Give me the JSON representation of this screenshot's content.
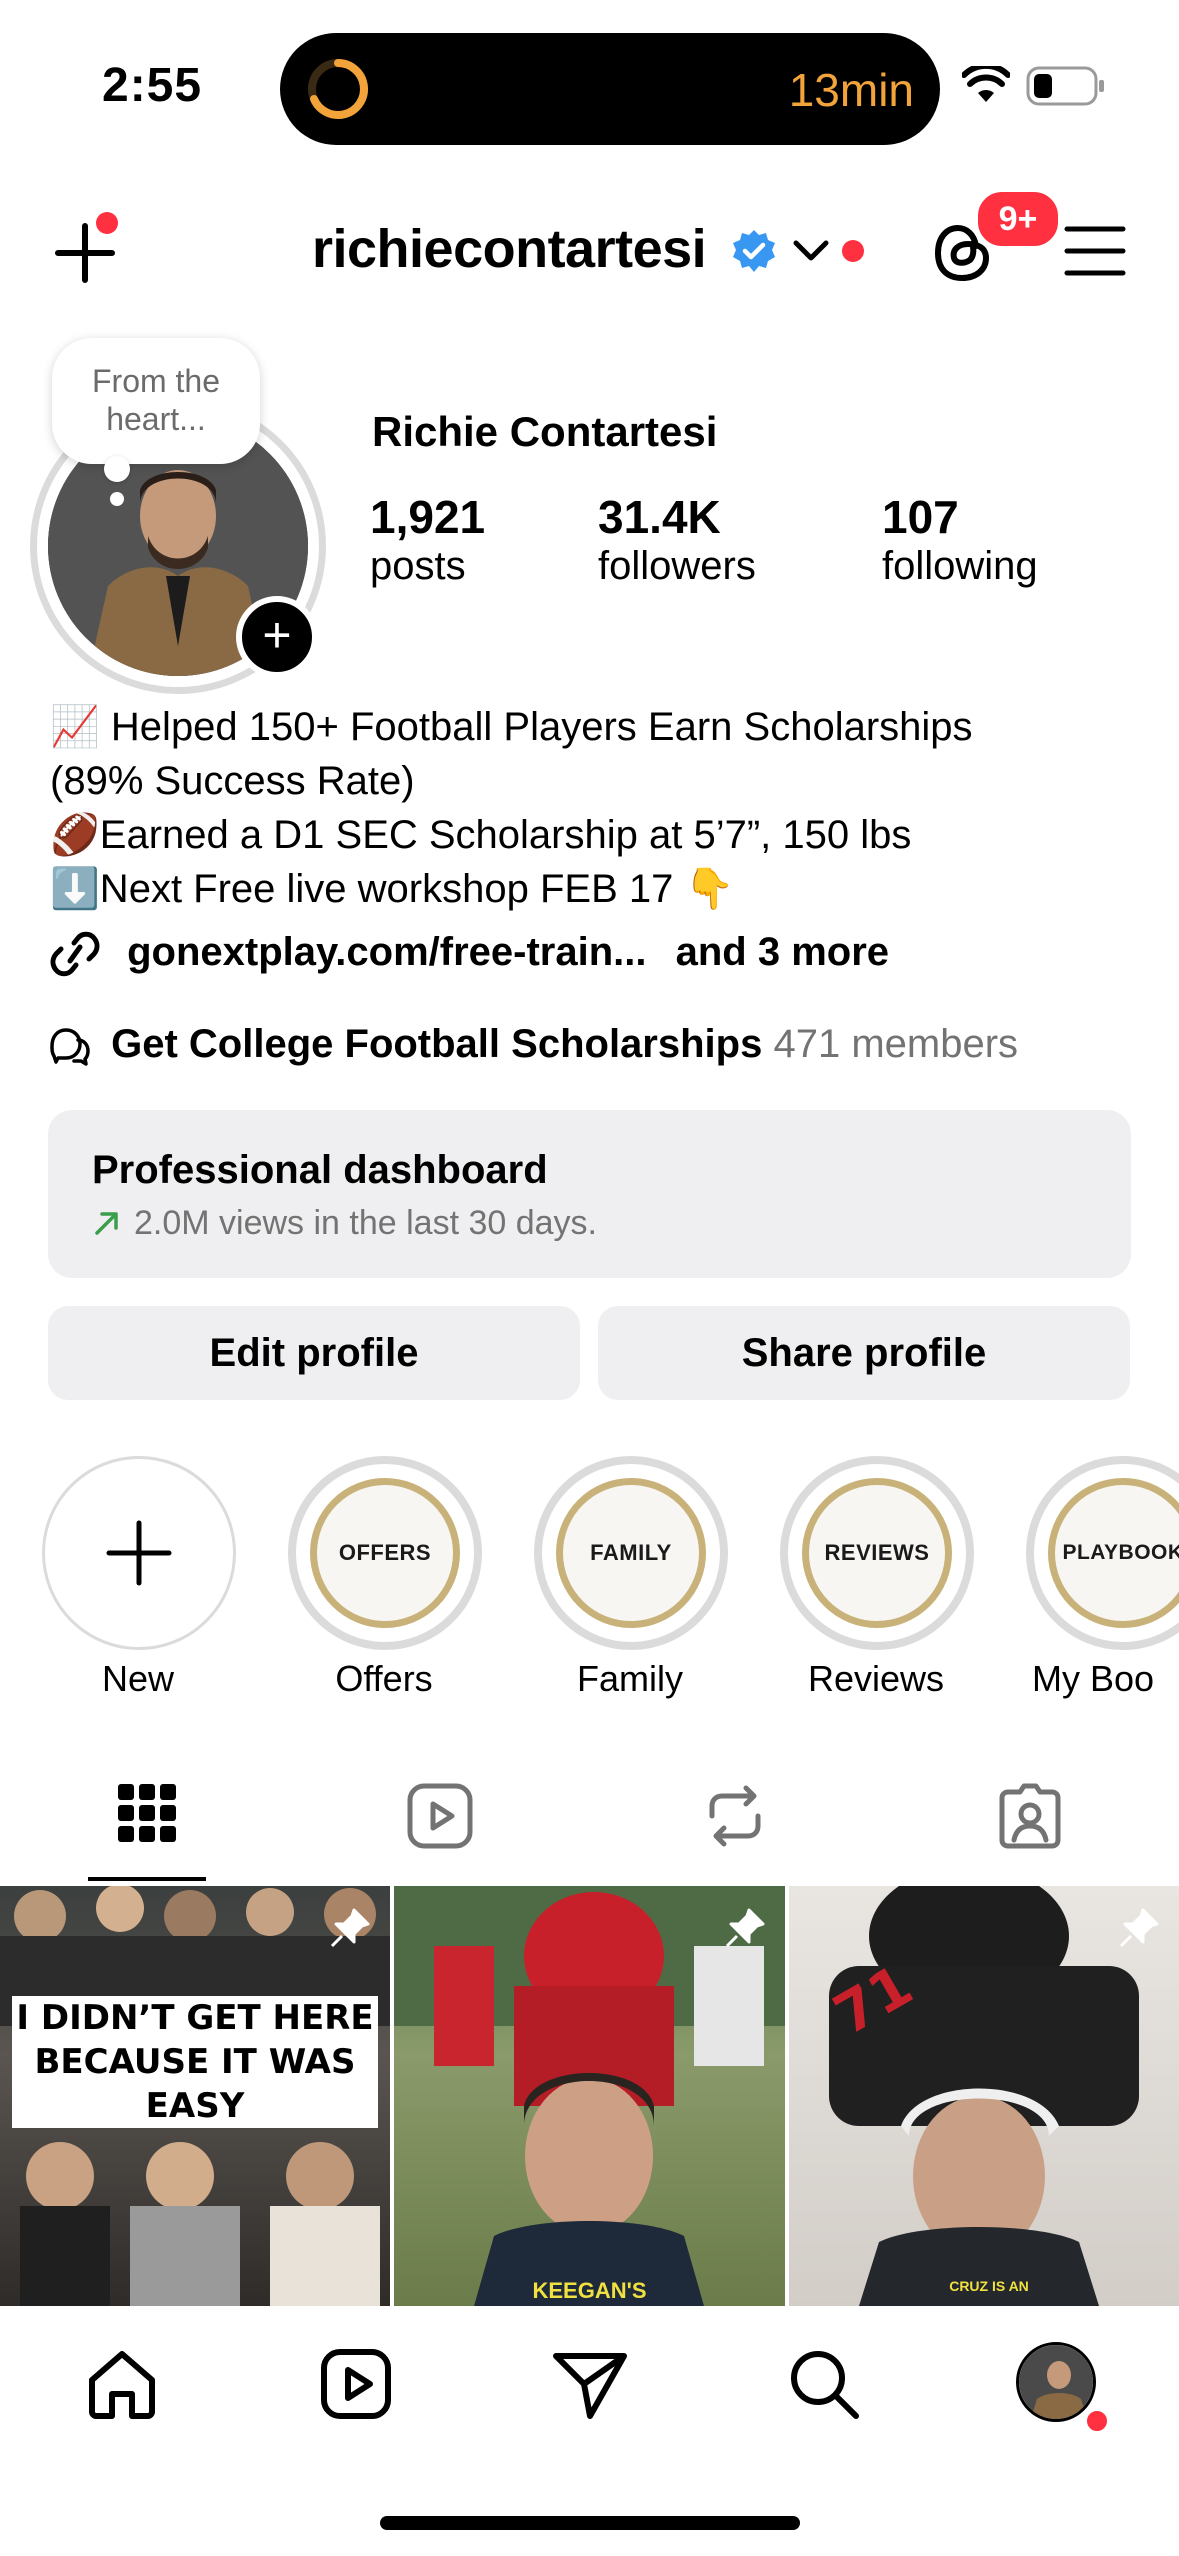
{
  "status_bar": {
    "time": "2:55",
    "live_activity_text": "13min"
  },
  "header": {
    "username": "richiecontartesi",
    "notification_badge": "9+"
  },
  "profile": {
    "note_bubble": "From the heart...",
    "full_name": "Richie Contartesi",
    "stats": [
      {
        "value": "1,921",
        "label": "posts"
      },
      {
        "value": "31.4K",
        "label": "followers"
      },
      {
        "value": "107",
        "label": "following"
      }
    ],
    "bio_lines": [
      "📈 Helped 150+ Football Players Earn Scholarships",
      "(89% Success Rate)",
      "🏈Earned a D1 SEC Scholarship at 5’7”, 150 lbs",
      "⬇️Next Free live workshop FEB 17 👇"
    ],
    "link_text": "gonextplay.com/free-train...",
    "link_more": "and 3 more",
    "community_name": "Get College Football Scholarships",
    "community_members": "471 members"
  },
  "dashboard": {
    "title": "Professional dashboard",
    "subtitle": "2.0M views in the last 30 days."
  },
  "buttons": {
    "edit": "Edit profile",
    "share": "Share profile"
  },
  "highlights": [
    {
      "label": "New",
      "cover": ""
    },
    {
      "label": "Offers",
      "cover": "OFFERS"
    },
    {
      "label": "Family",
      "cover": "FAMILY"
    },
    {
      "label": "Reviews",
      "cover": "REVIEWS"
    },
    {
      "label": "My Boo",
      "cover": "PLAYBOOK"
    }
  ],
  "posts": [
    {
      "caption_line1": "I DIDN’T GET HERE",
      "caption_line2": "BECAUSE IT WAS EASY",
      "pinned": true
    },
    {
      "caption_line1": "KEEGAN'S",
      "pinned": true
    },
    {
      "caption_line1": "CRUZ IS AN",
      "pinned": true
    }
  ],
  "colors": {
    "accent_red": "#ff3040",
    "verified_blue": "#3897f0",
    "timer_orange": "#f2a33a",
    "highlight_gold": "#c9b27a"
  }
}
